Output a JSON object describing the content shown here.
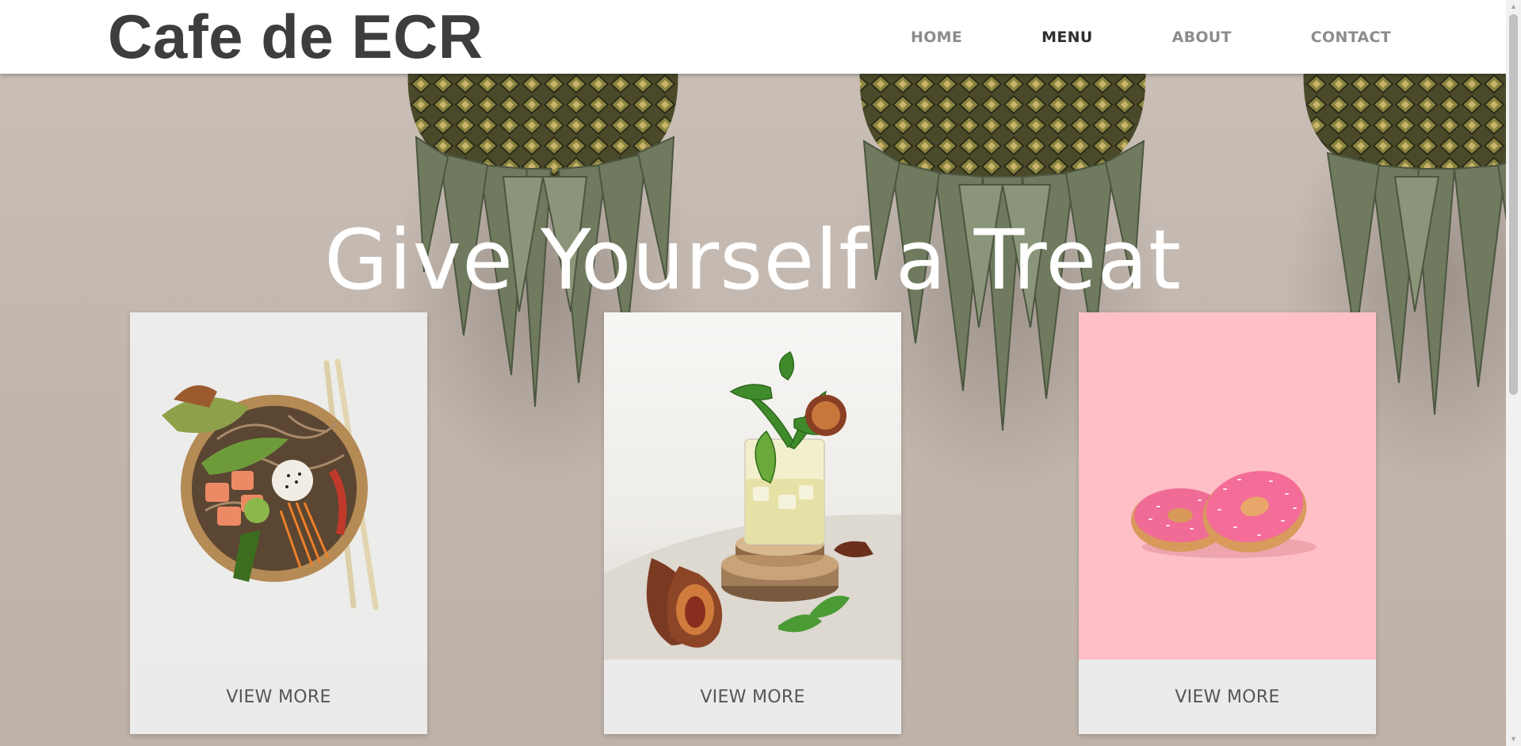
{
  "brand": {
    "name": "Cafe de ECR"
  },
  "nav": {
    "items": [
      {
        "label": "HOME",
        "active": false
      },
      {
        "label": "MENU",
        "active": true
      },
      {
        "label": "ABOUT",
        "active": false
      },
      {
        "label": "CONTACT",
        "active": false
      }
    ]
  },
  "hero": {
    "headline": "Give Yourself a Treat",
    "background": "pineapples-on-beige-wall"
  },
  "cards": [
    {
      "image": "poke-bowl-with-chopsticks",
      "button_label": "VIEW MORE",
      "image_bg": "#ececeb"
    },
    {
      "image": "mint-drink-with-figs",
      "button_label": "VIEW MORE",
      "image_bg": "#f4f3f1"
    },
    {
      "image": "pink-donuts",
      "button_label": "VIEW MORE",
      "image_bg": "#ffbfc6"
    }
  ],
  "colors": {
    "header_bg": "#ffffff",
    "brand_text": "#3d3d3d",
    "nav_text": "#8c8c8c",
    "nav_active": "#2e2e2e",
    "hero_bg": "#c2b8b0",
    "button_bg": "#ebebeb",
    "button_text": "#555555"
  }
}
